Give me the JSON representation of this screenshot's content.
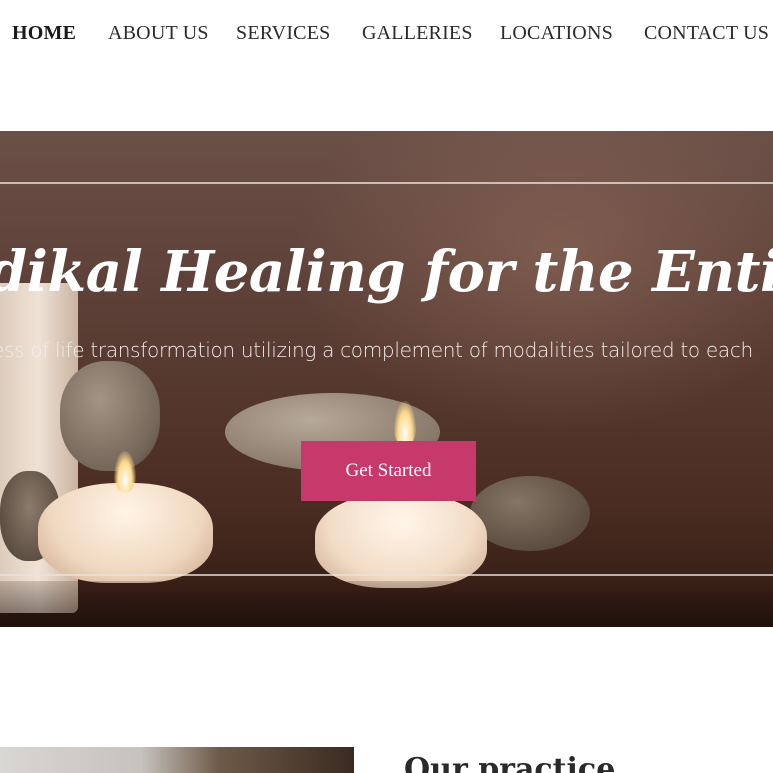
{
  "nav": {
    "items": [
      {
        "label": "HOME",
        "active": true
      },
      {
        "label": "ABOUT US",
        "active": false
      },
      {
        "label": "SERVICES",
        "active": false
      },
      {
        "label": "GALLERIES",
        "active": false
      },
      {
        "label": "LOCATIONS",
        "active": false
      },
      {
        "label": "CONTACT US",
        "active": false
      }
    ]
  },
  "hero": {
    "title": "dikal Healing for the Entire S",
    "subtitle": "ess of life transformation utilizing a complement of modalities tailored to each",
    "cta_label": "Get Started"
  },
  "section": {
    "heading": "Our practice"
  },
  "colors": {
    "accent": "#c7386b",
    "text": "#2b2b2b",
    "hero_text": "#ffffff"
  }
}
